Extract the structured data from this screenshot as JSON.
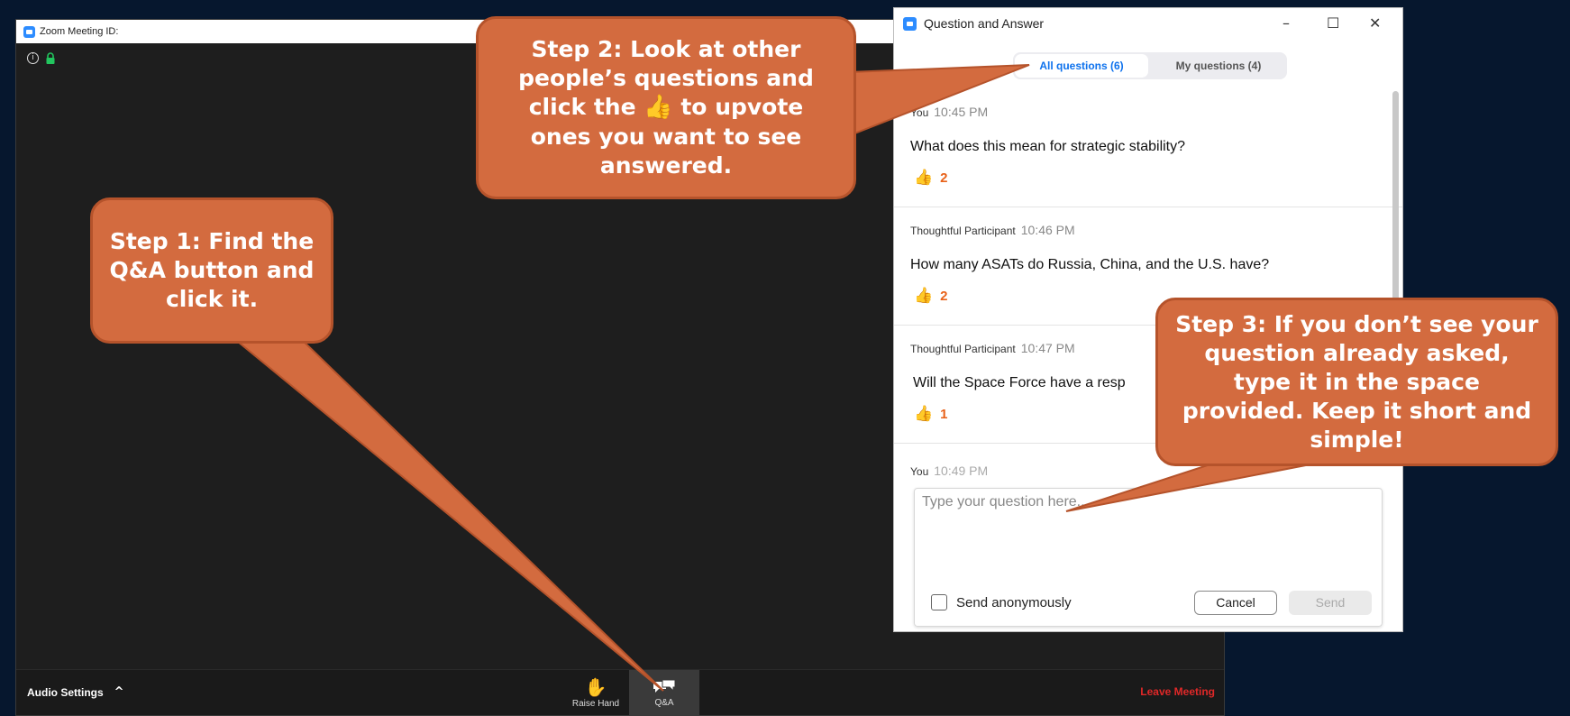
{
  "zoom": {
    "window_title": "Zoom Meeting ID:",
    "toolbar": {
      "audio_settings": "Audio Settings",
      "raise_hand": "Raise Hand",
      "qa": "Q&A",
      "leave": "Leave Meeting"
    }
  },
  "qa_panel": {
    "title": "Question and Answer",
    "tabs": [
      {
        "label": "All questions (6)",
        "active": true
      },
      {
        "label": "My questions (4)",
        "active": false
      }
    ],
    "questions": [
      {
        "author": "You",
        "time": "10:45 PM",
        "text": "What does this mean for strategic stability?",
        "upvotes": "2"
      },
      {
        "author": "Thoughtful Participant",
        "time": "10:46 PM",
        "text": "How many ASATs do Russia, China, and the U.S. have?",
        "upvotes": "2"
      },
      {
        "author": "Thoughtful Participant",
        "time": "10:47 PM",
        "text": "Will the Space Force have a resp",
        "upvotes": "1"
      }
    ],
    "compose": {
      "author": "You",
      "time": "10:49 PM",
      "placeholder": "Type your question here...",
      "anonymous_label": "Send anonymously",
      "cancel": "Cancel",
      "send": "Send"
    }
  },
  "callouts": {
    "step1": "Step 1: Find the Q&A button and click it.",
    "step2_before": "Step 2: Look at other people’s questions and click the",
    "step2_after": "to upvote ones you want to see answered.",
    "step3": "Step 3: If you don’t see your question already asked, type it in the space provided. Keep it short and simple!"
  },
  "colors": {
    "callout_fill": "#d36b3f",
    "accent_blue": "#0e72ed",
    "upvote_orange": "#e8621a",
    "leave_red": "#e02828"
  }
}
